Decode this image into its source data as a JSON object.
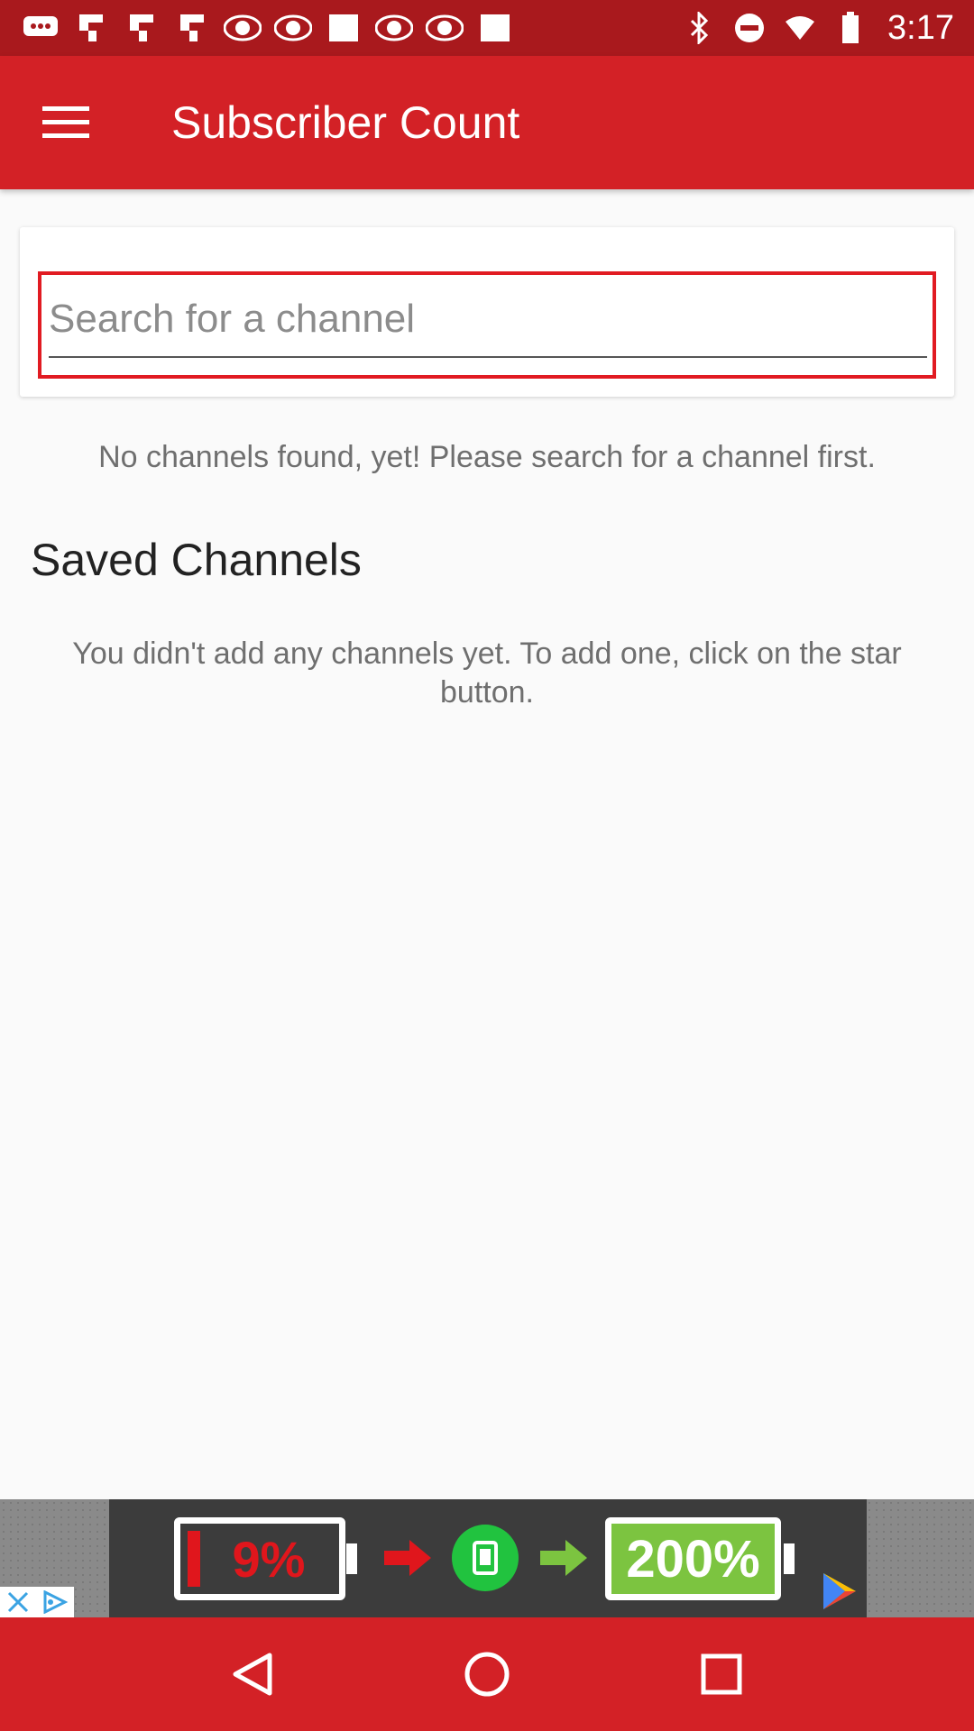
{
  "status_bar": {
    "time": "3:17",
    "icons": [
      "chat-icon",
      "flipboard-icon",
      "flipboard-icon",
      "flipboard-icon",
      "abc13-icon",
      "abc13-icon",
      "square-notification-icon",
      "abc13-icon",
      "abc13-icon",
      "square-notification-icon",
      "bluetooth-icon",
      "do-not-disturb-icon"
    ]
  },
  "app_bar": {
    "title": "Subscriber Count",
    "menu_icon": "hamburger-menu-icon",
    "color": "#d32126"
  },
  "search": {
    "placeholder": "Search for a channel",
    "value": ""
  },
  "results": {
    "empty_message": "No channels found, yet! Please search for a channel first."
  },
  "saved": {
    "title": "Saved Channels",
    "empty_message": "You didn't add any channels yet. To add one, click on the star button."
  },
  "ad": {
    "low_text": "9%",
    "high_text": "200%",
    "choices_icons": [
      "close-icon",
      "adchoices-icon"
    ]
  },
  "nav_bar": {
    "buttons": [
      "back-icon",
      "home-icon",
      "recents-icon"
    ]
  }
}
